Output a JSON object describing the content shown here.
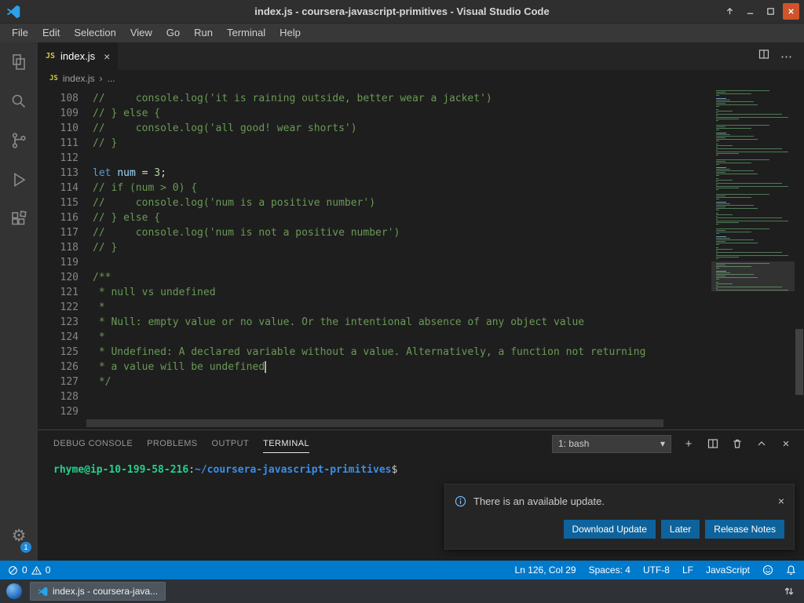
{
  "window": {
    "title": "index.js - coursera-javascript-primitives - Visual Studio Code"
  },
  "menu": [
    "File",
    "Edit",
    "Selection",
    "View",
    "Go",
    "Run",
    "Terminal",
    "Help"
  ],
  "icons": {
    "close": "×",
    "more": "⋯",
    "chevron_down": "▾",
    "plus": "+"
  },
  "tab": {
    "icon": "JS",
    "label": "index.js"
  },
  "breadcrumb": {
    "icon": "JS",
    "file": "index.js",
    "separator": "›",
    "more": "..."
  },
  "activity": {
    "badge": "1",
    "gear": "⚙"
  },
  "editor": {
    "cursor_line": 126,
    "lines": [
      {
        "n": 108,
        "s": [
          {
            "t": "//     console.log('it is raining outside, better wear a jacket')",
            "c": "comment"
          }
        ]
      },
      {
        "n": 109,
        "s": [
          {
            "t": "// } else {",
            "c": "comment"
          }
        ]
      },
      {
        "n": 110,
        "s": [
          {
            "t": "//     console.log('all good! wear shorts')",
            "c": "comment"
          }
        ]
      },
      {
        "n": 111,
        "s": [
          {
            "t": "// }",
            "c": "comment"
          }
        ]
      },
      {
        "n": 112,
        "s": []
      },
      {
        "n": 113,
        "s": [
          {
            "t": "let",
            "c": "kw"
          },
          {
            "t": " ",
            "c": "plain"
          },
          {
            "t": "num",
            "c": "var"
          },
          {
            "t": " = ",
            "c": "plain"
          },
          {
            "t": "3",
            "c": "num"
          },
          {
            "t": ";",
            "c": "plain"
          }
        ]
      },
      {
        "n": 114,
        "s": [
          {
            "t": "// if (num > 0) {",
            "c": "comment"
          }
        ]
      },
      {
        "n": 115,
        "s": [
          {
            "t": "//     console.log('num is a positive number')",
            "c": "comment"
          }
        ]
      },
      {
        "n": 116,
        "s": [
          {
            "t": "// } else {",
            "c": "comment"
          }
        ]
      },
      {
        "n": 117,
        "s": [
          {
            "t": "//     console.log('num is not a positive number')",
            "c": "comment"
          }
        ]
      },
      {
        "n": 118,
        "s": [
          {
            "t": "// }",
            "c": "comment"
          }
        ]
      },
      {
        "n": 119,
        "s": []
      },
      {
        "n": 120,
        "s": [
          {
            "t": "/**",
            "c": "comment"
          }
        ]
      },
      {
        "n": 121,
        "s": [
          {
            "t": " * null vs undefined",
            "c": "comment"
          }
        ]
      },
      {
        "n": 122,
        "s": [
          {
            "t": " *",
            "c": "comment"
          }
        ]
      },
      {
        "n": 123,
        "s": [
          {
            "t": " * Null: empty value or no value. Or the intentional absence of any object value",
            "c": "comment"
          }
        ]
      },
      {
        "n": 124,
        "s": [
          {
            "t": " *",
            "c": "comment"
          }
        ]
      },
      {
        "n": 125,
        "s": [
          {
            "t": " * Undefined: A declared variable without a value. Alternatively, a function not returning",
            "c": "comment"
          }
        ]
      },
      {
        "n": 126,
        "s": [
          {
            "t": " * a value will be undefined",
            "c": "comment"
          }
        ]
      },
      {
        "n": 127,
        "s": [
          {
            "t": " */",
            "c": "comment"
          }
        ]
      },
      {
        "n": 128,
        "s": []
      },
      {
        "n": 129,
        "s": []
      }
    ]
  },
  "panel": {
    "tabs": [
      {
        "label": "DEBUG CONSOLE",
        "active": false
      },
      {
        "label": "PROBLEMS",
        "active": false
      },
      {
        "label": "OUTPUT",
        "active": false
      },
      {
        "label": "TERMINAL",
        "active": true
      }
    ],
    "terminal_select": "1: bash"
  },
  "terminal": {
    "user": "rhyme@ip-10-199-58-216",
    "separator": ":",
    "path": "~/coursera-javascript-primitives",
    "prompt_symbol": "$"
  },
  "notification": {
    "message": "There is an available update.",
    "buttons": [
      "Download Update",
      "Later",
      "Release Notes"
    ]
  },
  "status": {
    "errors": "0",
    "warnings": "0",
    "items": [
      "Ln 126, Col 29",
      "Spaces: 4",
      "UTF-8",
      "LF",
      "JavaScript"
    ]
  },
  "taskbar": {
    "window_label": "index.js - coursera-java..."
  },
  "colors": {
    "statusbar": "#007acc",
    "accent_button": "#0e639c",
    "close_button": "#d0532b"
  }
}
